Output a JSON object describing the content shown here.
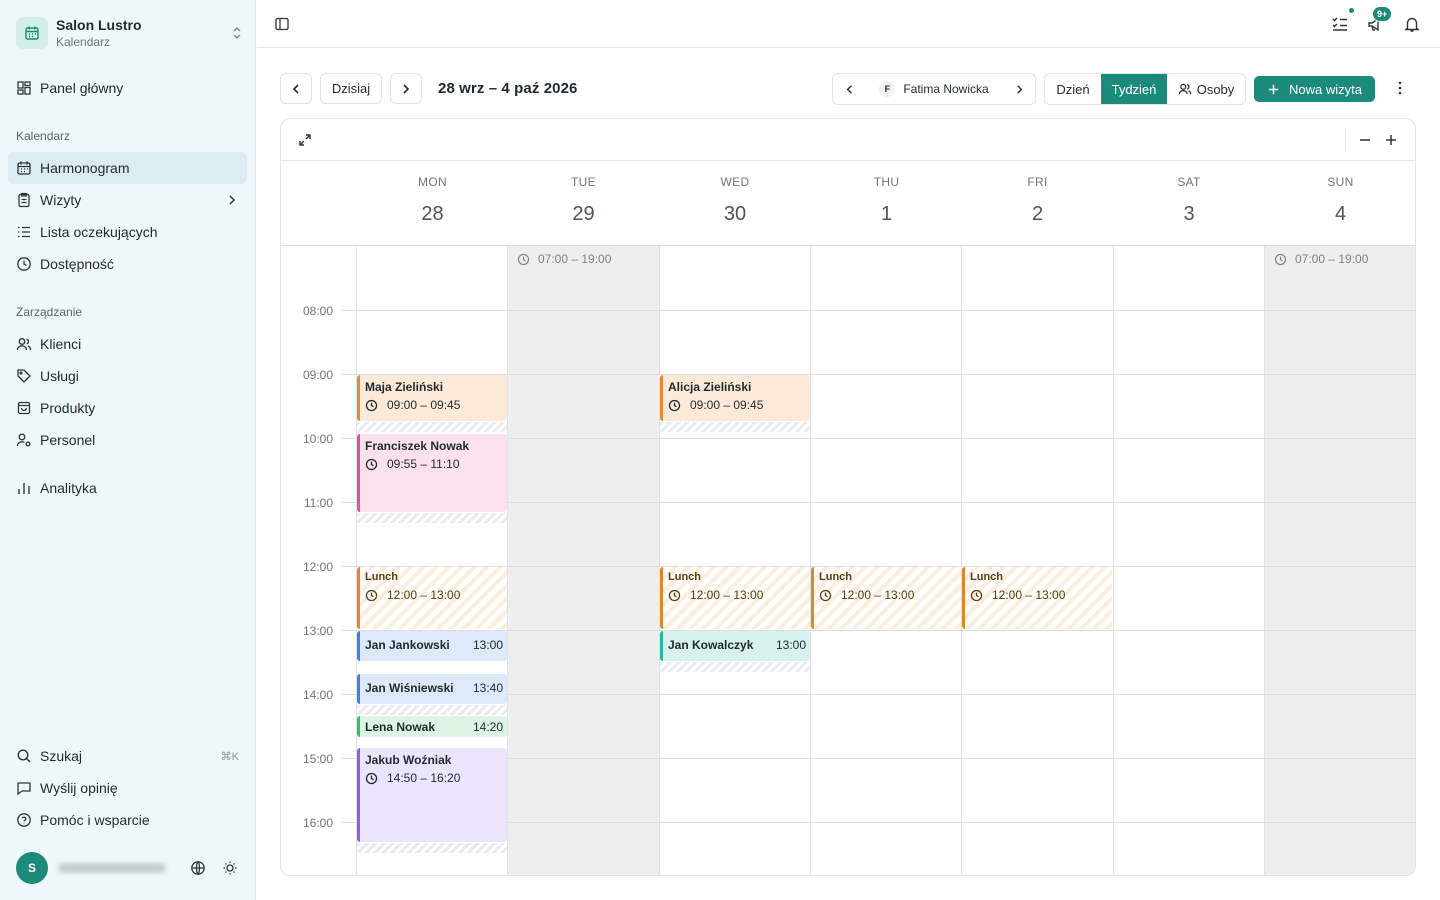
{
  "sidebar": {
    "org_name": "Salon Lustro",
    "org_sub": "Kalendarz",
    "dashboard": "Panel główny",
    "section_calendar": "Kalendarz",
    "schedule": "Harmonogram",
    "visits": "Wizyty",
    "waitlist": "Lista oczekujących",
    "availability": "Dostępność",
    "section_manage": "Zarządzanie",
    "clients": "Klienci",
    "services": "Usługi",
    "products": "Produkty",
    "staff": "Personel",
    "analytics": "Analityka",
    "search": "Szukaj",
    "search_kbd": "⌘K",
    "feedback": "Wyślij opinię",
    "help": "Pomóc i wsparcie",
    "user_initial": "S"
  },
  "topbar": {
    "notifications_badge": "9+"
  },
  "toolbar": {
    "today": "Dzisiaj",
    "range": "28 wrz – 4 paź 2026",
    "person_initial": "F",
    "person_name": "Fatima Nowicka",
    "view_day": "Dzień",
    "view_week": "Tydzień",
    "view_people": "Osoby",
    "new_visit": "Nowa wizyta"
  },
  "calendar": {
    "days": [
      {
        "dow": "MON",
        "num": "28"
      },
      {
        "dow": "TUE",
        "num": "29"
      },
      {
        "dow": "WED",
        "num": "30"
      },
      {
        "dow": "THU",
        "num": "1"
      },
      {
        "dow": "FRI",
        "num": "2"
      },
      {
        "dow": "SAT",
        "num": "3"
      },
      {
        "dow": "SUN",
        "num": "4"
      }
    ],
    "hours": [
      "08:00",
      "09:00",
      "10:00",
      "11:00",
      "12:00",
      "13:00",
      "14:00",
      "15:00",
      "16:00"
    ],
    "off_hours_label": "07:00 – 19:00",
    "events": {
      "e1": {
        "name": "Maja Zieliński",
        "time": "09:00 – 09:45"
      },
      "e2": {
        "name": "Alicja Zieliński",
        "time": "09:00 – 09:45"
      },
      "e3": {
        "name": "Franciszek Nowak",
        "time": "09:55 – 11:10"
      },
      "l1": {
        "name": "Lunch",
        "time": "12:00 – 13:00"
      },
      "l2": {
        "name": "Lunch",
        "time": "12:00 – 13:00"
      },
      "l3": {
        "name": "Lunch",
        "time": "12:00 – 13:00"
      },
      "l4": {
        "name": "Lunch",
        "time": "12:00 – 13:00"
      },
      "e4": {
        "name": "Jan Jankowski",
        "time": "13:00"
      },
      "e5": {
        "name": "Jan Kowalczyk",
        "time": "13:00"
      },
      "e6": {
        "name": "Jan Wiśniewski",
        "time": "13:40"
      },
      "e7": {
        "name": "Lena Nowak",
        "time": "14:20"
      },
      "e8": {
        "name": "Jakub Woźniak",
        "time": "14:50 – 16:20"
      }
    }
  },
  "colors": {
    "accent": "#1b8a7a",
    "orange": "#e08a3c",
    "pink": "#d9559a",
    "blue": "#4a7fd4",
    "teal": "#2bb3a3",
    "green": "#3fb96b",
    "purple": "#8b5cf6",
    "lunch": "#d98a2b"
  }
}
